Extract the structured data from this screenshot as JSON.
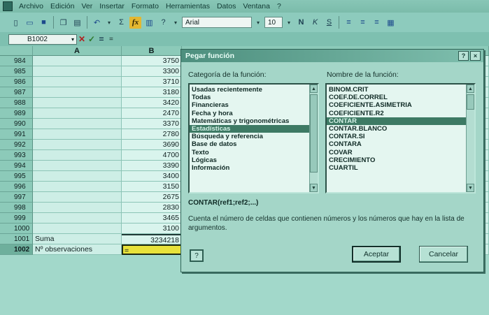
{
  "menubar": {
    "items": [
      "Archivo",
      "Edición",
      "Ver",
      "Insertar",
      "Formato",
      "Herramientas",
      "Datos",
      "Ventana",
      "?"
    ]
  },
  "toolbar": {
    "font_name": "Arial",
    "font_size": "10",
    "bold_label": "N",
    "italic_label": "K",
    "underline_label": "S",
    "sum_label": "Σ",
    "fx_label": "fx"
  },
  "formula_bar": {
    "name_box": "B1002",
    "cancel_label": "✕",
    "enter_label": "✓",
    "equals_label": "=",
    "content": "="
  },
  "sheet": {
    "columns": [
      "A",
      "B"
    ],
    "rows": [
      {
        "num": "984",
        "a": "",
        "b": "3750"
      },
      {
        "num": "985",
        "a": "",
        "b": "3300"
      },
      {
        "num": "986",
        "a": "",
        "b": "3710"
      },
      {
        "num": "987",
        "a": "",
        "b": "3180"
      },
      {
        "num": "988",
        "a": "",
        "b": "3420"
      },
      {
        "num": "989",
        "a": "",
        "b": "2470"
      },
      {
        "num": "990",
        "a": "",
        "b": "3370"
      },
      {
        "num": "991",
        "a": "",
        "b": "2780"
      },
      {
        "num": "992",
        "a": "",
        "b": "3690"
      },
      {
        "num": "993",
        "a": "",
        "b": "4700"
      },
      {
        "num": "994",
        "a": "",
        "b": "3390"
      },
      {
        "num": "995",
        "a": "",
        "b": "3400"
      },
      {
        "num": "996",
        "a": "",
        "b": "3150"
      },
      {
        "num": "997",
        "a": "",
        "b": "2675"
      },
      {
        "num": "998",
        "a": "",
        "b": "2830"
      },
      {
        "num": "999",
        "a": "",
        "b": "3465"
      },
      {
        "num": "1000",
        "a": "",
        "b": "3100"
      },
      {
        "num": "1001",
        "a": "Suma",
        "b": "3234218"
      },
      {
        "num": "1002",
        "a": "Nº observaciones",
        "b": "="
      }
    ]
  },
  "dialog": {
    "title": "Pegar función",
    "help_title_btn": "?",
    "close_btn": "×",
    "category_label": "Categoría de la función:",
    "function_label": "Nombre de la función:",
    "categories": [
      "Usadas recientemente",
      "Todas",
      "Financieras",
      "Fecha y hora",
      "Matemáticas y trigonométricas",
      "Estadísticas",
      "Búsqueda y referencia",
      "Base de datos",
      "Texto",
      "Lógicas",
      "Información"
    ],
    "selected_category": 5,
    "functions": [
      "BINOM.CRIT",
      "COEF.DE.CORREL",
      "COEFICIENTE.ASIMETRIA",
      "COEFICIENTE.R2",
      "CONTAR",
      "CONTAR.BLANCO",
      "CONTAR.SI",
      "CONTARA",
      "COVAR",
      "CRECIMIENTO",
      "CUARTIL"
    ],
    "selected_function": 4,
    "syntax": "CONTAR(ref1;ref2;...)",
    "description": "Cuenta el número de celdas que contienen números y los números que hay en la lista de argumentos.",
    "help_button": "?",
    "accept_button": "Aceptar",
    "cancel_button": "Cancelar"
  }
}
